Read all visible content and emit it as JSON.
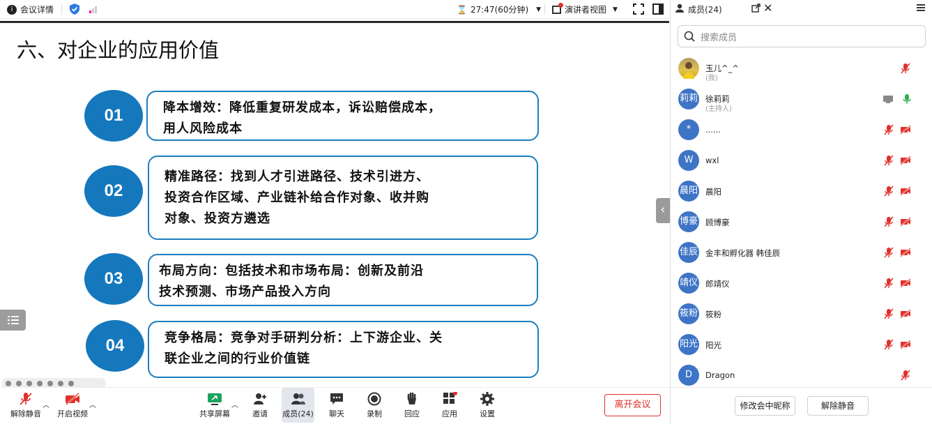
{
  "topbar": {
    "meeting_info": "会议详情",
    "timer": "27:47(60分钟)",
    "view": "演讲者视图"
  },
  "slide": {
    "title": "六、对企业的应用价值",
    "items": [
      {
        "num": "01",
        "lines": [
          "降本增效：降低重复研发成本，诉讼赔偿成本，",
          "用人风险成本"
        ]
      },
      {
        "num": "02",
        "lines": [
          "精准路径：找到人才引进路径、技术引进方、",
          "投资合作区域、产业链补给合作对象、收并购",
          "对象、投资方遴选"
        ]
      },
      {
        "num": "03",
        "lines": [
          "布局方向：包括技术和市场布局：创新及前沿",
          "技术预测、市场产品投入方向"
        ]
      },
      {
        "num": "04",
        "lines": [
          "竞争格局：竞争对手研判分析：上下游企业、关",
          "联企业之间的行业价值链"
        ]
      }
    ]
  },
  "toolbar": {
    "unmute": "解除静音",
    "video": "开启视频",
    "share": "共享屏幕",
    "invite": "邀请",
    "members": "成员(24)",
    "chat": "聊天",
    "record": "录制",
    "react": "回应",
    "apps": "应用",
    "settings": "设置",
    "leave": "离开会议"
  },
  "panel": {
    "title": "成员(24)",
    "search_placeholder": "搜索成员",
    "rename": "修改会中昵称",
    "unmute_all": "解除静音",
    "members": [
      {
        "name": "玉儿^_^",
        "sub": "(我)",
        "avatar": "",
        "photo": true
      },
      {
        "name": "徐莉莉",
        "sub": "(主持人)",
        "avatar": "莉莉"
      },
      {
        "name": "......",
        "sub": "",
        "avatar": "*"
      },
      {
        "name": "wxl",
        "sub": "",
        "avatar": "W"
      },
      {
        "name": "晨阳",
        "sub": "",
        "avatar": "晨阳"
      },
      {
        "name": "顾博豪",
        "sub": "",
        "avatar": "博豪"
      },
      {
        "name": "金丰和孵化器 韩佳辰",
        "sub": "",
        "avatar": "佳辰"
      },
      {
        "name": "郎靖仪",
        "sub": "",
        "avatar": "靖仪"
      },
      {
        "name": "筱粉",
        "sub": "",
        "avatar": "筱粉"
      },
      {
        "name": "阳光",
        "sub": "",
        "avatar": "阳光"
      },
      {
        "name": "Dragon",
        "sub": "",
        "avatar": "D"
      }
    ]
  },
  "colors": {
    "accent": "#1578bd",
    "danger": "#e0312b",
    "avatar": "#3e74c6"
  }
}
